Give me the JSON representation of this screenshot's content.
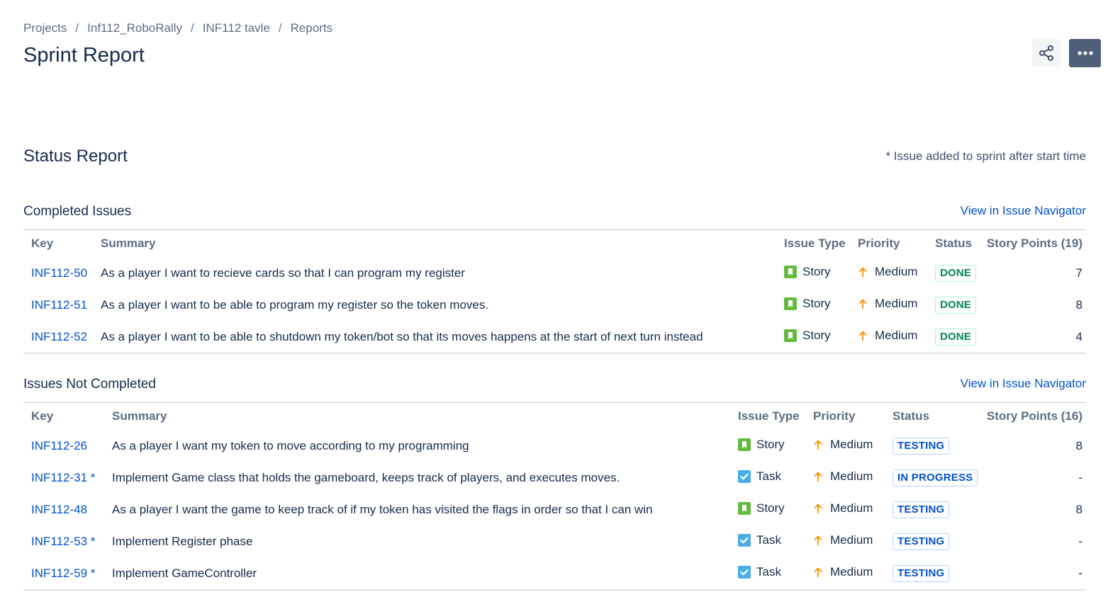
{
  "breadcrumb": [
    "Projects",
    "Inf112_RoboRally",
    "INF112 tavle",
    "Reports"
  ],
  "title": "Sprint Report",
  "header_actions": {
    "share_icon": "share-icon",
    "more_icon": "more-icon"
  },
  "status_report": {
    "heading": "Status Report",
    "note": "* Issue added to sprint after start time"
  },
  "completed": {
    "title": "Completed Issues",
    "nav_link": "View in Issue Navigator",
    "columns": {
      "key": "Key",
      "summary": "Summary",
      "type": "Issue Type",
      "priority": "Priority",
      "status": "Status",
      "points": "Story Points (19)"
    },
    "rows": [
      {
        "key": "INF112-50",
        "summary": "As a player I want to recieve cards so that I can program my register",
        "type": "Story",
        "priority": "Medium",
        "status": "DONE",
        "points": "7"
      },
      {
        "key": "INF112-51",
        "summary": "As a player I want to be able to program my register so the token moves.",
        "type": "Story",
        "priority": "Medium",
        "status": "DONE",
        "points": "8"
      },
      {
        "key": "INF112-52",
        "summary": "As a player I want to be able to shutdown my token/bot so that its moves happens at the start of next turn instead",
        "type": "Story",
        "priority": "Medium",
        "status": "DONE",
        "points": "4"
      }
    ]
  },
  "not_completed": {
    "title": "Issues Not Completed",
    "nav_link": "View in Issue Navigator",
    "columns": {
      "key": "Key",
      "summary": "Summary",
      "type": "Issue Type",
      "priority": "Priority",
      "status": "Status",
      "points": "Story Points (16)"
    },
    "rows": [
      {
        "key": "INF112-26",
        "summary": "As a player I want my token to move according to my programming",
        "type": "Story",
        "priority": "Medium",
        "status": "TESTING",
        "points": "8"
      },
      {
        "key": "INF112-31 *",
        "summary": "Implement Game class that holds the gameboard, keeps track of players, and executes moves.",
        "type": "Task",
        "priority": "Medium",
        "status": "IN PROGRESS",
        "points": "-"
      },
      {
        "key": "INF112-48",
        "summary": "As a player I want the game to keep track of if my token has visited the flags in order so that I can win",
        "type": "Story",
        "priority": "Medium",
        "status": "TESTING",
        "points": "8"
      },
      {
        "key": "INF112-53 *",
        "summary": "Implement Register phase",
        "type": "Task",
        "priority": "Medium",
        "status": "TESTING",
        "points": "-"
      },
      {
        "key": "INF112-59 *",
        "summary": "Implement GameController",
        "type": "Task",
        "priority": "Medium",
        "status": "TESTING",
        "points": "-"
      }
    ]
  },
  "colors": {
    "link": "#0052cc",
    "story": "#63ba3c",
    "task": "#4bade8",
    "priority_medium": "#ff8b00",
    "done": "#00875a",
    "testing": "#0052cc"
  }
}
